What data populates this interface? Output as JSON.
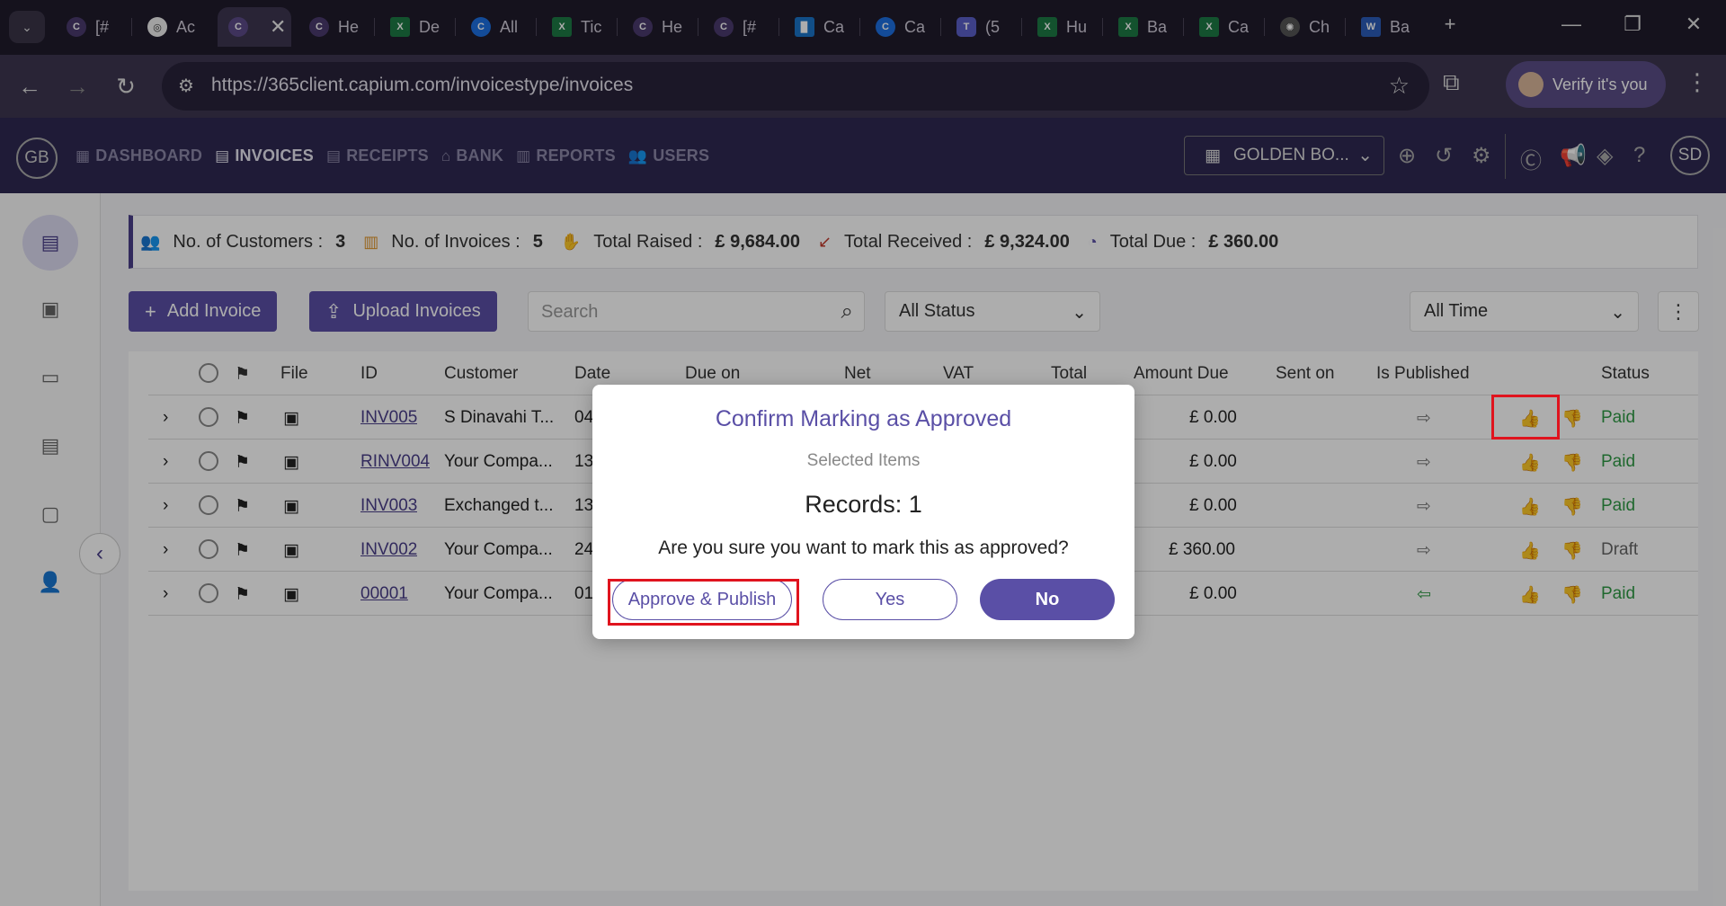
{
  "browser": {
    "tabs": [
      {
        "label": "[#",
        "icon": "capium-icon"
      },
      {
        "label": "Ac",
        "icon": "chrome-app-icon"
      },
      {
        "label": "",
        "icon": "capium-icon",
        "active": true
      },
      {
        "label": "He",
        "icon": "capium-icon"
      },
      {
        "label": "De",
        "icon": "excel-icon"
      },
      {
        "label": "All",
        "icon": "capium-c-icon"
      },
      {
        "label": "Tic",
        "icon": "excel-icon"
      },
      {
        "label": "He",
        "icon": "capium-icon"
      },
      {
        "label": "[#",
        "icon": "capium-icon"
      },
      {
        "label": "Ca",
        "icon": "azure-icon"
      },
      {
        "label": "Ca",
        "icon": "capium-c-icon"
      },
      {
        "label": "(5",
        "icon": "teams-icon"
      },
      {
        "label": "Hu",
        "icon": "excel-icon"
      },
      {
        "label": "Ba",
        "icon": "excel-icon"
      },
      {
        "label": "Ca",
        "icon": "excel-icon"
      },
      {
        "label": "Ch",
        "icon": "chatgpt-icon"
      },
      {
        "label": "Ba",
        "icon": "word-icon"
      }
    ],
    "url": "https://365client.capium.com/invoicestype/invoices",
    "verify_label": "Verify it's you"
  },
  "app": {
    "logo": "GB",
    "nav": [
      {
        "label": "DASHBOARD",
        "icon": "grid-icon"
      },
      {
        "label": "INVOICES",
        "icon": "invoice-icon",
        "active": true
      },
      {
        "label": "RECEIPTS",
        "icon": "receipt-icon"
      },
      {
        "label": "BANK",
        "icon": "bank-icon"
      },
      {
        "label": "REPORTS",
        "icon": "chart-icon"
      },
      {
        "label": "USERS",
        "icon": "users-icon"
      }
    ],
    "company": "GOLDEN BO...",
    "user_initials": "SD"
  },
  "stats": {
    "customers_label": "No. of Customers :",
    "customers_value": "3",
    "invoices_label": "No. of Invoices :",
    "invoices_value": "5",
    "raised_label": "Total Raised :",
    "raised_value": "£ 9,684.00",
    "received_label": "Total Received :",
    "received_value": "£ 9,324.00",
    "due_label": "Total Due :",
    "due_value": "£ 360.00"
  },
  "toolbar": {
    "add_invoice": "Add Invoice",
    "upload_invoices": "Upload Invoices",
    "search_placeholder": "Search",
    "status_filter": "All Status",
    "time_filter": "All Time"
  },
  "table": {
    "headers": {
      "file": "File",
      "id": "ID",
      "customer": "Customer",
      "date": "Date",
      "due_on": "Due on",
      "net": "Net",
      "vat": "VAT",
      "total": "Total",
      "amount_due": "Amount Due",
      "sent_on": "Sent on",
      "is_published": "Is Published",
      "status": "Status"
    },
    "rows": [
      {
        "id": "INV005",
        "customer": "S Dinavahi T...",
        "date": "04",
        "amount_due": "£ 0.00",
        "status": "Paid"
      },
      {
        "id": "RINV004",
        "customer": "Your Compa...",
        "date": "13",
        "amount_due": "£ 0.00",
        "status": "Paid"
      },
      {
        "id": "INV003",
        "customer": "Exchanged t...",
        "date": "13",
        "amount_due": "£ 0.00",
        "status": "Paid"
      },
      {
        "id": "INV002",
        "customer": "Your Compa...",
        "date": "24",
        "amount_due": "£ 360.00",
        "status": "Draft"
      },
      {
        "id": "00001",
        "customer": "Your Compa...",
        "date": "01",
        "amount_due": "£ 0.00",
        "status": "Paid"
      }
    ]
  },
  "modal": {
    "title": "Confirm Marking as Approved",
    "subtitle": "Selected Items",
    "records": "Records: 1",
    "question": "Are you sure you want to mark this as approved?",
    "approve_publish": "Approve & Publish",
    "yes": "Yes",
    "no": "No"
  }
}
